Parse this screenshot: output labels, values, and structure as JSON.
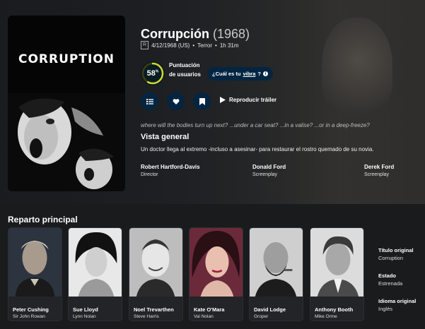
{
  "movie": {
    "poster_title": "CORRUPTION",
    "title": "Corrupción",
    "year": "(1968)",
    "certification": "R",
    "release": "4/12/1968 (US)",
    "genre": "Terror",
    "runtime": "1h 31m",
    "score": "58",
    "score_unit": "%",
    "score_fraction": 0.58,
    "score_label": "Puntuación de usuarios",
    "vibe_prefix": "¿Cuál es tu ",
    "vibe_link": "vibra",
    "vibe_suffix": "?",
    "trailer": "Reproducir tráiler",
    "tagline": "where will the bodies turn up next? ...under a car seat? ...in a valise? ...or in a deep-freeze?",
    "overview_heading": "Vista general",
    "overview": "Un doctor llega al extremo -incluso a asesinar- para restaurar el rostro quemado de su novia.",
    "crew": [
      {
        "name": "Robert Hartford-Davis",
        "job": "Director"
      },
      {
        "name": "Donald Ford",
        "job": "Screenplay"
      },
      {
        "name": "Derek Ford",
        "job": "Screenplay"
      }
    ]
  },
  "cast": {
    "heading": "Reparto principal",
    "members": [
      {
        "name": "Peter Cushing",
        "role": "Sir John Rowan"
      },
      {
        "name": "Sue Lloyd",
        "role": "Lynn Nolan"
      },
      {
        "name": "Noel Trevarthen",
        "role": "Steve Harris"
      },
      {
        "name": "Kate O'Mara",
        "role": "Val Nolan"
      },
      {
        "name": "David Lodge",
        "role": "Groper"
      },
      {
        "name": "Anthony Booth",
        "role": "Mike Orme"
      }
    ]
  },
  "facts": [
    {
      "label": "Título original",
      "value": "Corruption"
    },
    {
      "label": "Estado",
      "value": "Estrenada"
    },
    {
      "label": "Idioma original",
      "value": "Inglés"
    }
  ],
  "colors": {
    "accent_dark_blue": "#032541",
    "score_ring": "#d2d531",
    "score_track": "#423d0f"
  }
}
